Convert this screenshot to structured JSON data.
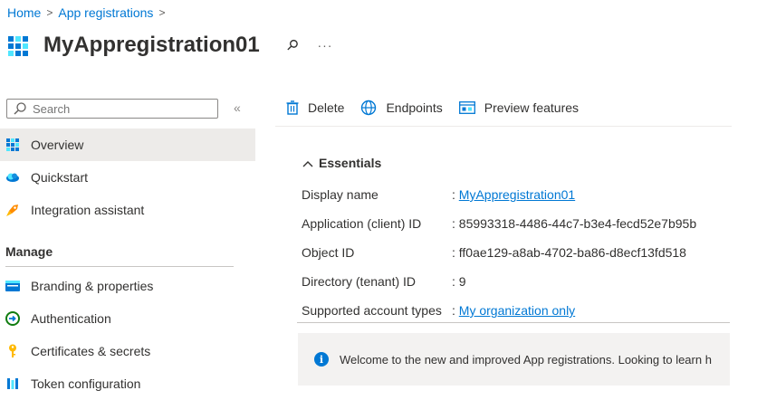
{
  "breadcrumb": {
    "home": "Home",
    "app_registrations": "App registrations",
    "sep": ">"
  },
  "header": {
    "title": "MyAppregistration01",
    "more": "···"
  },
  "sidebar": {
    "search_placeholder": "Search",
    "collapse": "«",
    "items": [
      {
        "label": "Overview",
        "icon": "app-grid-icon"
      },
      {
        "label": "Quickstart",
        "icon": "cloud-icon"
      },
      {
        "label": "Integration assistant",
        "icon": "rocket-icon"
      }
    ],
    "section": "Manage",
    "manage_items": [
      {
        "label": "Branding & properties",
        "icon": "branding-icon"
      },
      {
        "label": "Authentication",
        "icon": "authentication-icon"
      },
      {
        "label": "Certificates & secrets",
        "icon": "key-icon"
      },
      {
        "label": "Token configuration",
        "icon": "token-icon"
      }
    ]
  },
  "toolbar": {
    "delete": "Delete",
    "endpoints": "Endpoints",
    "preview": "Preview features"
  },
  "essentials": {
    "header": "Essentials",
    "rows": [
      {
        "key": "Display name",
        "sep": ":",
        "value": "MyAppregistration01",
        "link": true
      },
      {
        "key": "Application (client) ID",
        "sep": ":",
        "value": "85993318-4486-44c7-b3e4-fecd52e7b95b",
        "link": false
      },
      {
        "key": "Object ID",
        "sep": ":",
        "value": "ff0ae129-a8ab-4702-ba86-d8ecf13fd518",
        "link": false
      },
      {
        "key": "Directory (tenant) ID",
        "sep": ":",
        "value": "9",
        "link": false
      },
      {
        "key": "Supported account types",
        "sep": ":",
        "value": "My organization only",
        "link": true
      }
    ]
  },
  "info_banner": {
    "text": "Welcome to the new and improved App registrations. Looking to learn h"
  },
  "colors": {
    "accent": "#0078d4",
    "active_bg": "#edebe9",
    "banner_bg": "#f3f2f1"
  }
}
